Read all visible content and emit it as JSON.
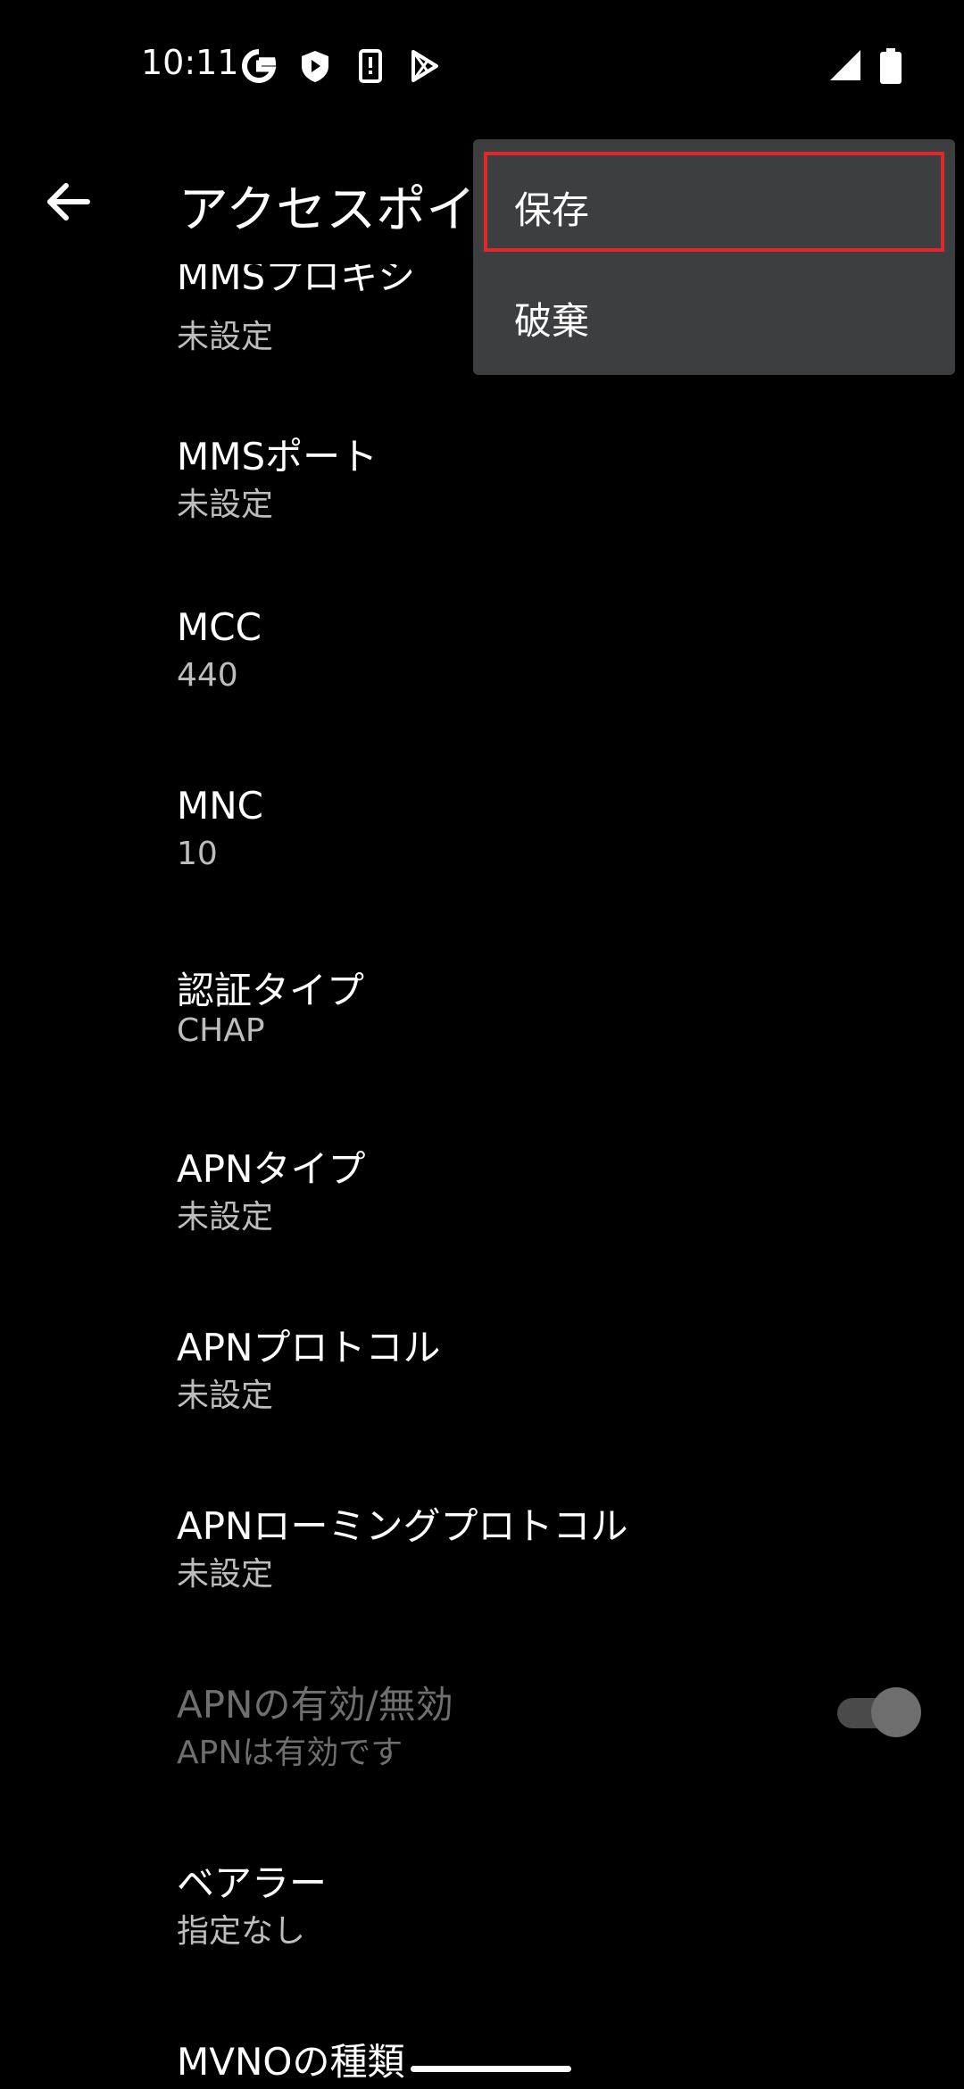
{
  "status_bar": {
    "time": "10:11",
    "icons": [
      "google-icon",
      "shield-icon",
      "device-alert-icon",
      "play-store-icon"
    ],
    "right_icons": [
      "signal-icon",
      "battery-icon"
    ]
  },
  "app_bar": {
    "title": "アクセスポイ",
    "back_icon": "arrow-back-icon"
  },
  "menu": {
    "items": [
      {
        "label": "保存"
      },
      {
        "label": "破棄"
      }
    ],
    "highlight_color": "#e0272c"
  },
  "settings": [
    {
      "title": "MMSプロキシ",
      "summary": "未設定"
    },
    {
      "title": "MMSポート",
      "summary": "未設定"
    },
    {
      "title": "MCC",
      "summary": "440"
    },
    {
      "title": "MNC",
      "summary": "10"
    },
    {
      "title": "認証タイプ",
      "summary": "CHAP"
    },
    {
      "title": "APNタイプ",
      "summary": "未設定"
    },
    {
      "title": "APNプロトコル",
      "summary": "未設定"
    },
    {
      "title": "APNローミングプロトコル",
      "summary": "未設定"
    },
    {
      "title": "APNの有効/無効",
      "summary": "APNは有効です",
      "toggle": true,
      "disabled": true
    },
    {
      "title": "ベアラー",
      "summary": "指定なし"
    },
    {
      "title": "MVNOの種類",
      "summary": ""
    }
  ]
}
